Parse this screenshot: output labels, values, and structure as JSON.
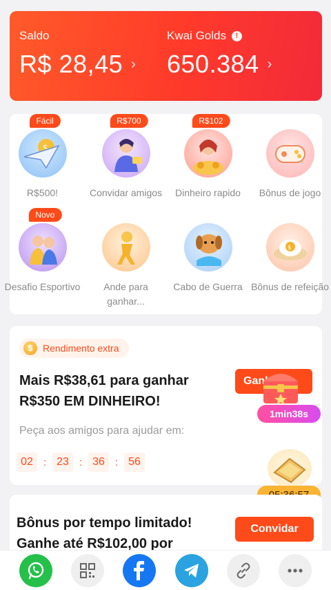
{
  "balance": {
    "saldo_label": "Saldo",
    "saldo_value": "R$ 28,45",
    "golds_label": "Kwai Golds",
    "golds_value": "650.384",
    "chevron": "›",
    "info_glyph": "!"
  },
  "grid": {
    "items": [
      {
        "label": "R$500!",
        "tag": "Fácil",
        "icon": "paper-plane-coin-icon"
      },
      {
        "label": "Convidar amigos",
        "tag": "R$700",
        "icon": "invite-friends-icon"
      },
      {
        "label": "Dinheiro rapido",
        "tag": "R$102",
        "icon": "money-girl-icon"
      },
      {
        "label": "Bônus de jogo",
        "tag": "",
        "icon": "gamepad-icon"
      },
      {
        "label": "Desafio Esportivo",
        "tag": "Novo",
        "icon": "sport-challenge-icon"
      },
      {
        "label": "Ande para ganhar...",
        "tag": "",
        "icon": "walk-icon"
      },
      {
        "label": "Cabo de Guerra",
        "tag": "",
        "icon": "tug-of-war-dog-icon"
      },
      {
        "label": "Bônus de refeição",
        "tag": "",
        "icon": "meal-egg-icon"
      }
    ]
  },
  "extra": {
    "pill_label": "Rendimento extra",
    "coin_glyph": "$",
    "title": "Mais R$38,61 para ganhar R$350 EM DINHEIRO!",
    "ask_text": "Peça aos amigos para ajudar em:",
    "timer": [
      "02",
      "23",
      "36",
      "56"
    ],
    "timer_sep": ":",
    "button_label": "Ganhar",
    "float_timer_1": "1min38s",
    "float_timer_2": "05:36:57"
  },
  "bonus": {
    "title": "Bônus por tempo limitado! Ganhe até R$102,00 por",
    "button_label": "Convidar"
  },
  "share": {
    "buttons": [
      "whatsapp-icon",
      "qr-code-icon",
      "facebook-icon",
      "telegram-icon",
      "link-icon",
      "more-icon"
    ]
  },
  "colors": {
    "accent": "#ff4a1a",
    "header_gradient_start": "#ff5a2a",
    "header_gradient_end": "#f22a3a",
    "whatsapp": "#25c04a",
    "facebook": "#1677f2",
    "telegram": "#2aa3e0"
  }
}
